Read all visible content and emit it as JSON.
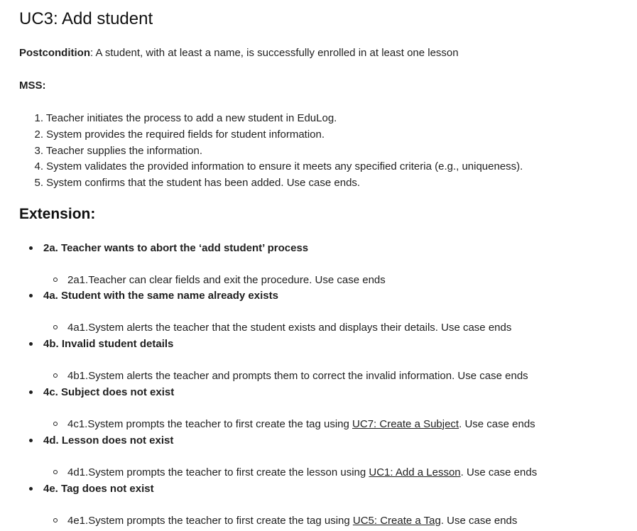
{
  "title": "UC3: Add student",
  "postcondition": {
    "label": "Postcondition",
    "text": ": A student, with at least a name, is successfully enrolled in at least one lesson"
  },
  "mss": {
    "label": "MSS:",
    "steps": [
      {
        "num": "1.",
        "text": "Teacher initiates the process to add a new student in EduLog."
      },
      {
        "num": "2.",
        "text": "System provides the required fields for student information."
      },
      {
        "num": "3.",
        "text": "Teacher supplies the information."
      },
      {
        "num": "4.",
        "text": "System validates the provided information to ensure it meets any specified criteria (e.g., uniqueness)."
      },
      {
        "num": "5.",
        "text": "System confirms that the student has been added. Use case ends."
      }
    ]
  },
  "extension": {
    "heading": "Extension:",
    "items": [
      {
        "head": "2a. Teacher wants to abort the ‘add student’ process",
        "sub_before": "2a1.Teacher can clear fields and exit the procedure. Use case ends",
        "link": "",
        "sub_after": ""
      },
      {
        "head": "4a. Student with the same name already exists",
        "sub_before": "4a1.System alerts the teacher that the student exists and displays their details. Use case ends",
        "link": "",
        "sub_after": ""
      },
      {
        "head": "4b. Invalid student details",
        "sub_before": "4b1.System alerts the teacher and prompts them to correct the invalid information. Use case ends",
        "link": "",
        "sub_after": ""
      },
      {
        "head": "4c. Subject does not exist",
        "sub_before": "4c1.System prompts the teacher to first create the tag using ",
        "link": "UC7: Create a Subject",
        "sub_after": ". Use case ends"
      },
      {
        "head": "4d. Lesson does not exist",
        "sub_before": "4d1.System prompts the teacher to first create the lesson using ",
        "link": "UC1: Add a Lesson",
        "sub_after": ". Use case ends"
      },
      {
        "head": "4e. Tag does not exist",
        "sub_before": "4e1.System prompts the teacher to first create the tag using ",
        "link": "UC5: Create a Tag",
        "sub_after": ". Use case ends"
      }
    ]
  }
}
